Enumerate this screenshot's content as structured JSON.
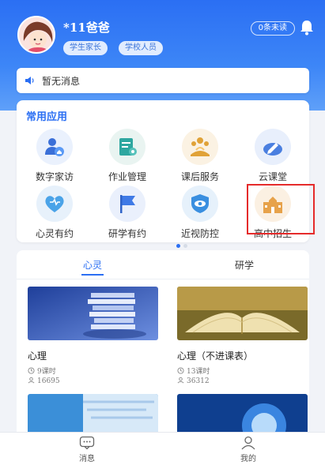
{
  "header": {
    "username": "*11爸爸",
    "roles": [
      "学生家长",
      "学校人员"
    ],
    "unread": "0条未读"
  },
  "notice": {
    "text": "暂无消息"
  },
  "apps": {
    "title": "常用应用",
    "items": [
      {
        "label": "数字家访",
        "icon": "home-visit-icon"
      },
      {
        "label": "作业管理",
        "icon": "homework-icon"
      },
      {
        "label": "课后服务",
        "icon": "after-school-icon"
      },
      {
        "label": "云课堂",
        "icon": "cloud-class-icon"
      },
      {
        "label": "心灵有约",
        "icon": "heart-icon"
      },
      {
        "label": "研学有约",
        "icon": "flag-icon"
      },
      {
        "label": "近视防控",
        "icon": "eye-shield-icon"
      },
      {
        "label": "高中招生",
        "icon": "school-building-icon"
      }
    ],
    "pager": {
      "pages": 2,
      "active": 1
    }
  },
  "courses": {
    "tabs": [
      "心灵",
      "研学"
    ],
    "active_tab": "心灵",
    "items": [
      {
        "title": "心理",
        "lessons": "9课时",
        "views": "16695"
      },
      {
        "title": "心理（不进课表）",
        "lessons": "13课时",
        "views": "36312"
      }
    ]
  },
  "nav": {
    "items": [
      {
        "label": "消息",
        "icon": "message-icon"
      },
      {
        "label": "我的",
        "icon": "user-icon"
      }
    ]
  },
  "colors": {
    "brand": "#2b6ff3",
    "highlight": "#e52b2b"
  }
}
